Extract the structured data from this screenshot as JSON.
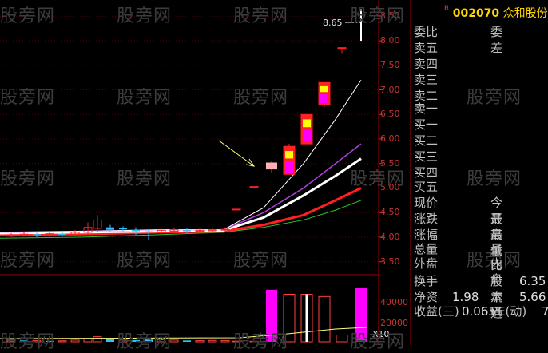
{
  "stock": {
    "r_mark": "R",
    "code": "002070",
    "name": "众和股份"
  },
  "chart_data": {
    "type": "candlestick",
    "price_axis_ticks": [
      "8.50",
      "8.00",
      "7.50",
      "7.00",
      "6.50",
      "6.00",
      "5.50",
      "5.00",
      "4.50",
      "4.00",
      "3.50"
    ],
    "price_range": [
      3.3,
      8.7
    ],
    "high_label": "8.65",
    "volume_axis_ticks": [
      "40000",
      "20000"
    ],
    "volume_unit": "X10",
    "colors": {
      "up": "#ff2020",
      "down": "#30c0ff",
      "ma5": "#ffffff",
      "ma10": "#ffffff",
      "ma20": "#b040e0",
      "ma30": "#ff2020",
      "ma60": "#30c030",
      "vol_up": "#ff00ff"
    }
  },
  "watermark": "股旁网",
  "panel": {
    "weibi_label": "委比",
    "weicha_label": "委差",
    "sell": [
      "卖五",
      "卖四",
      "卖三",
      "卖二",
      "卖一"
    ],
    "buy": [
      "买一",
      "买二",
      "买三",
      "买四",
      "买五"
    ],
    "quote_left": [
      "现价",
      "涨跌",
      "涨幅",
      "总量",
      "外盘"
    ],
    "quote_right": [
      "今开",
      "最高",
      "最低",
      "量比",
      "内盘"
    ],
    "stats": {
      "turnover_label": "换手",
      "share_capital_label": "股本",
      "share_capital_value": "6.35",
      "nav_label": "净资",
      "nav_value": "1.98",
      "float_label": "流通",
      "float_value": "5.66",
      "eps_label": "收益(三)",
      "eps_value": "0.065",
      "pe_label": "PE(动)",
      "pe_value": "7"
    }
  }
}
